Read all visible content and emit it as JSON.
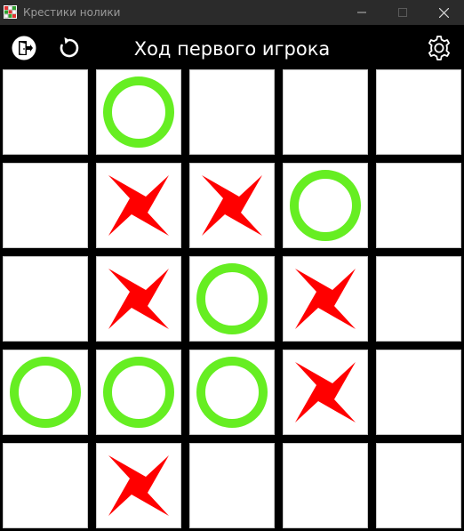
{
  "window": {
    "title": "Крестики нолики"
  },
  "toolbar": {
    "exit_icon": "exit-door-icon",
    "restart_icon": "restart-arrow-icon",
    "settings_icon": "gear-icon",
    "turn_text": "Ход первого игрока"
  },
  "board": {
    "rows": 5,
    "cols": 5,
    "cells": [
      [
        "",
        "O",
        "",
        "",
        ""
      ],
      [
        "",
        "X",
        "X",
        "O",
        ""
      ],
      [
        "",
        "X",
        "O",
        "X",
        ""
      ],
      [
        "O",
        "O",
        "O",
        "X",
        ""
      ],
      [
        "",
        "X",
        "",
        "",
        ""
      ]
    ]
  },
  "colors": {
    "x_mark": "#ff0000",
    "o_mark": "#66ee22",
    "cell_bg": "#ffffff",
    "board_bg": "#000000",
    "titlebar_bg": "#2b2b2b"
  }
}
